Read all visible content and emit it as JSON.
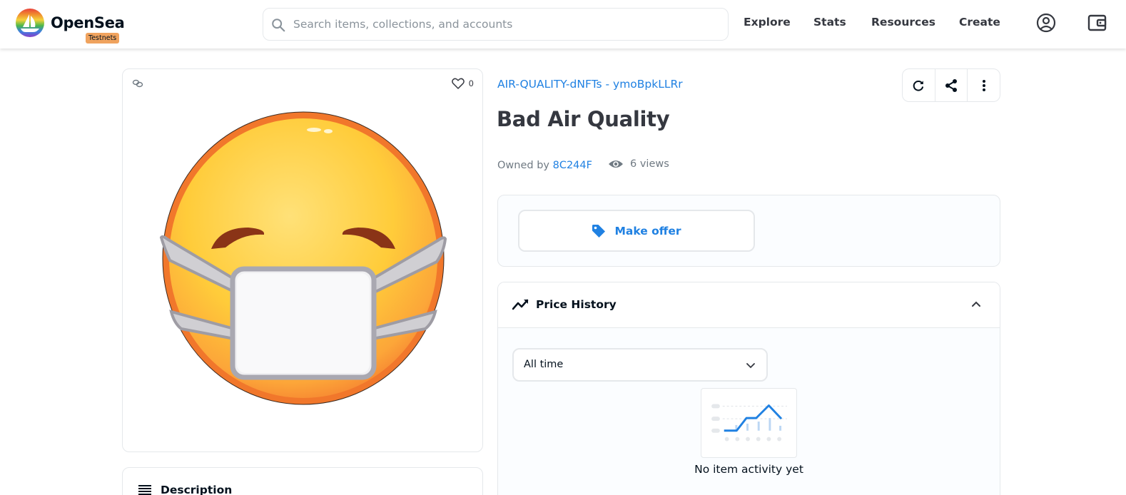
{
  "header": {
    "logo_text": "OpenSea",
    "badge": "Testnets",
    "search_placeholder": "Search items, collections, and accounts",
    "nav": [
      "Explore",
      "Stats",
      "Resources",
      "Create"
    ],
    "icons": [
      "account-icon",
      "wallet-icon"
    ]
  },
  "asset": {
    "favorites_count": "0",
    "collection": "AIR-QUALITY-dNFTs - ymoBpkLLRr",
    "title": "Bad Air Quality",
    "owned_by_label": "Owned by",
    "owner": "8C244F",
    "views": "6 views"
  },
  "actions": [
    "refresh-icon",
    "share-icon",
    "more-icon"
  ],
  "offer": {
    "button_label": "Make offer"
  },
  "price_history": {
    "title": "Price History",
    "range_selected": "All time",
    "empty_text": "No item activity yet"
  },
  "description": {
    "title": "Description"
  },
  "colors": {
    "accent": "#2081e2",
    "border": "#e5e8eb",
    "badge": "#f0a35e",
    "text": "#04111d"
  }
}
